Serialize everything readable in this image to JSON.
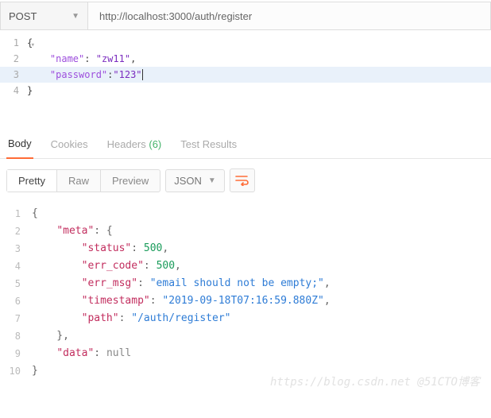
{
  "request": {
    "method": "POST",
    "url": "http://localhost:3000/auth/register",
    "body_lines": [
      {
        "n": "1",
        "text_parts": [
          [
            "p",
            "{"
          ]
        ],
        "fold": "▾"
      },
      {
        "n": "2",
        "text_parts": [
          [
            "p",
            "    "
          ],
          [
            "k",
            "\"name\""
          ],
          [
            "p",
            ": "
          ],
          [
            "s",
            "\"zw11\""
          ],
          [
            "p",
            ","
          ]
        ]
      },
      {
        "n": "3",
        "text_parts": [
          [
            "p",
            "    "
          ],
          [
            "k",
            "\"password\""
          ],
          [
            "p",
            ":"
          ],
          [
            "s",
            "\"123\""
          ]
        ],
        "active": true,
        "cursor": true
      },
      {
        "n": "4",
        "text_parts": [
          [
            "p",
            "}"
          ]
        ]
      }
    ]
  },
  "tabs": {
    "body": "Body",
    "cookies": "Cookies",
    "headers": "Headers",
    "headers_count": "(6)",
    "test_results": "Test Results"
  },
  "subbar": {
    "pretty": "Pretty",
    "raw": "Raw",
    "preview": "Preview",
    "format": "JSON"
  },
  "response": {
    "lines": [
      {
        "n": "1",
        "parts": [
          [
            "rp",
            "{"
          ]
        ]
      },
      {
        "n": "2",
        "parts": [
          [
            "rp",
            "    "
          ],
          [
            "rk",
            "\"meta\""
          ],
          [
            "rp",
            ": {"
          ]
        ]
      },
      {
        "n": "3",
        "parts": [
          [
            "rp",
            "        "
          ],
          [
            "rk",
            "\"status\""
          ],
          [
            "rp",
            ": "
          ],
          [
            "rn",
            "500"
          ],
          [
            "rp",
            ","
          ]
        ]
      },
      {
        "n": "4",
        "parts": [
          [
            "rp",
            "        "
          ],
          [
            "rk",
            "\"err_code\""
          ],
          [
            "rp",
            ": "
          ],
          [
            "rn",
            "500"
          ],
          [
            "rp",
            ","
          ]
        ]
      },
      {
        "n": "5",
        "parts": [
          [
            "rp",
            "        "
          ],
          [
            "rk",
            "\"err_msg\""
          ],
          [
            "rp",
            ": "
          ],
          [
            "rs",
            "\"email should not be empty;\""
          ],
          [
            "rp",
            ","
          ]
        ]
      },
      {
        "n": "6",
        "parts": [
          [
            "rp",
            "        "
          ],
          [
            "rk",
            "\"timestamp\""
          ],
          [
            "rp",
            ": "
          ],
          [
            "rs",
            "\"2019-09-18T07:16:59.880Z\""
          ],
          [
            "rp",
            ","
          ]
        ]
      },
      {
        "n": "7",
        "parts": [
          [
            "rp",
            "        "
          ],
          [
            "rk",
            "\"path\""
          ],
          [
            "rp",
            ": "
          ],
          [
            "rs",
            "\"/auth/register\""
          ]
        ]
      },
      {
        "n": "8",
        "parts": [
          [
            "rp",
            "    },"
          ]
        ]
      },
      {
        "n": "9",
        "parts": [
          [
            "rp",
            "    "
          ],
          [
            "rk",
            "\"data\""
          ],
          [
            "rp",
            ": "
          ],
          [
            "rnull",
            "null"
          ]
        ]
      },
      {
        "n": "10",
        "parts": [
          [
            "rp",
            "}"
          ]
        ]
      }
    ]
  },
  "watermark": "https://blog.csdn.net @51CTO博客"
}
